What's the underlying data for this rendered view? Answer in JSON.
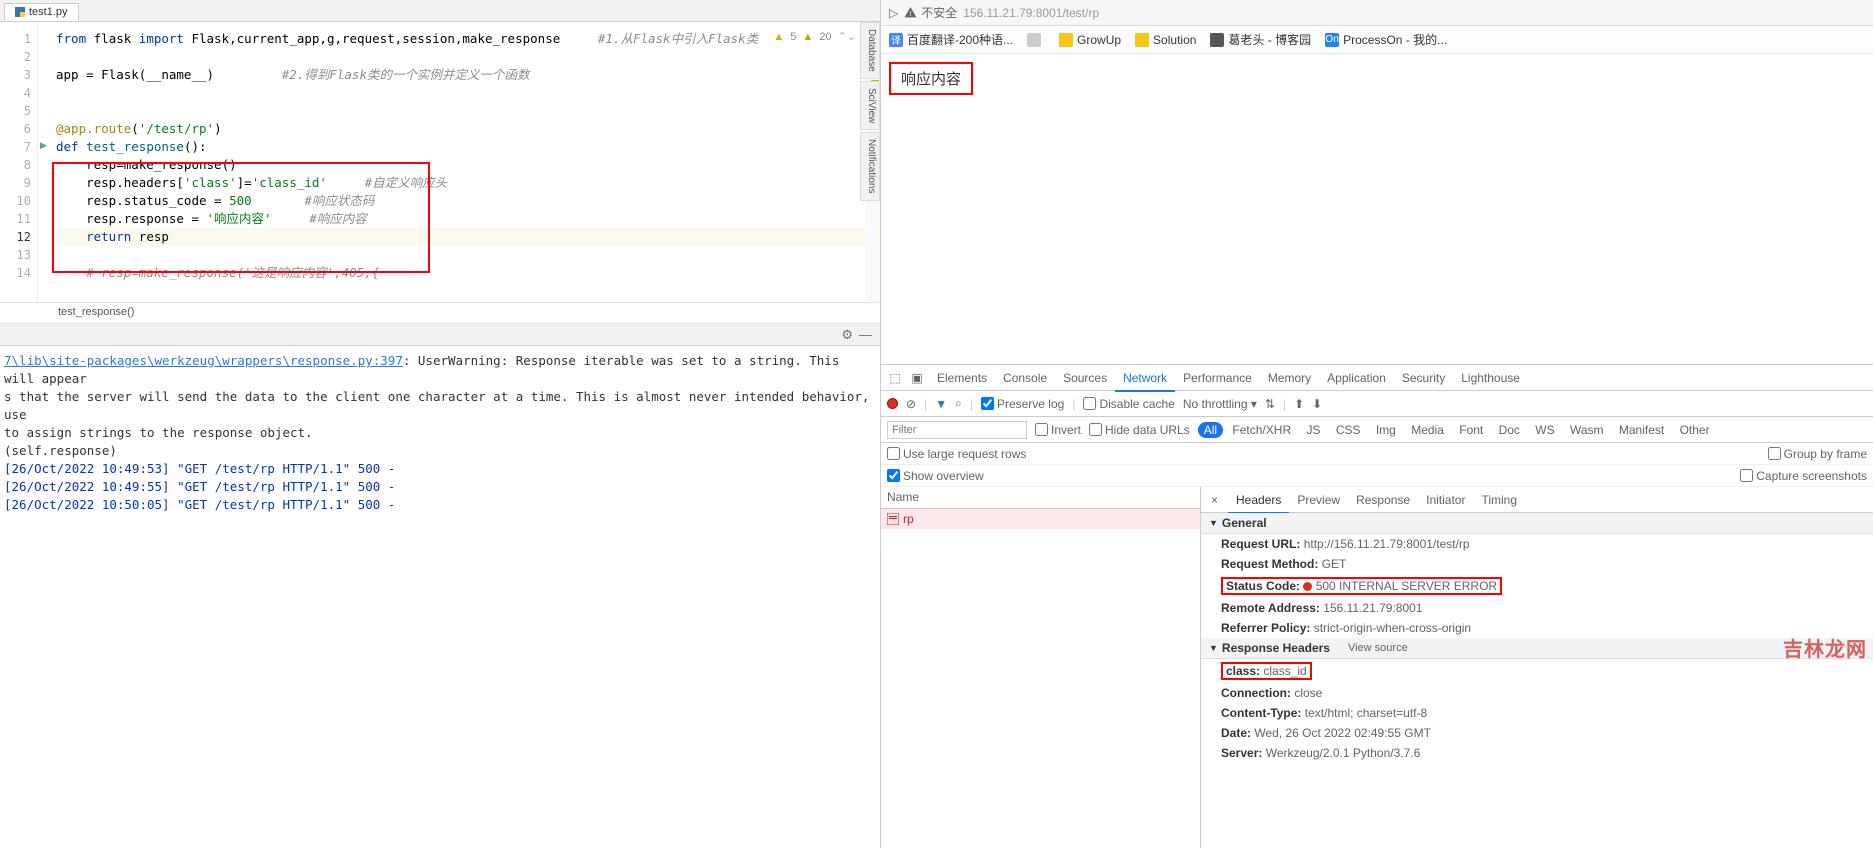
{
  "ide": {
    "tab": {
      "name": "test1.py"
    },
    "inspections": {
      "err": "5",
      "warn": "20"
    },
    "gutter_lines": [
      "1",
      "2",
      "3",
      "4",
      "5",
      "6",
      "7",
      "8",
      "9",
      "10",
      "11",
      "12",
      "13",
      "14"
    ],
    "active_line_idx": 11,
    "code_lines": [
      {
        "parts": [
          {
            "cls": "tok-kw",
            "t": "from "
          },
          {
            "cls": "tok-id",
            "t": "flask "
          },
          {
            "cls": "tok-kw",
            "t": "import "
          },
          {
            "cls": "tok-id",
            "t": "Flask,current_app,g,request,session,make_response     "
          },
          {
            "cls": "tok-cmt",
            "t": "#1.从Flask中引入Flask类"
          }
        ]
      },
      {
        "parts": []
      },
      {
        "parts": [
          {
            "cls": "tok-id",
            "t": "app = Flask(__name__)         "
          },
          {
            "cls": "tok-cmt",
            "t": "#2.得到Flask类的一个实例并定义一个函数"
          }
        ]
      },
      {
        "parts": []
      },
      {
        "parts": []
      },
      {
        "parts": [
          {
            "cls": "tok-dec",
            "t": "@app.route"
          },
          {
            "cls": "tok-punc",
            "t": "("
          },
          {
            "cls": "tok-str",
            "t": "'/test/rp'"
          },
          {
            "cls": "tok-punc",
            "t": ")"
          }
        ]
      },
      {
        "parts": [
          {
            "cls": "tok-kw",
            "t": "def "
          },
          {
            "cls": "tok-deffn",
            "t": "test_response"
          },
          {
            "cls": "tok-punc",
            "t": "():"
          }
        ]
      },
      {
        "parts": [
          {
            "cls": "tok-id",
            "t": "    resp=make_response()"
          }
        ]
      },
      {
        "parts": [
          {
            "cls": "tok-id",
            "t": "    resp.headers["
          },
          {
            "cls": "tok-str",
            "t": "'class'"
          },
          {
            "cls": "tok-id",
            "t": "]="
          },
          {
            "cls": "tok-str",
            "t": "'class_id'"
          },
          {
            "cls": "tok-id",
            "t": "     "
          },
          {
            "cls": "tok-cmt",
            "t": "#自定义响应头"
          }
        ]
      },
      {
        "parts": [
          {
            "cls": "tok-id",
            "t": "    resp.status_code = "
          },
          {
            "cls": "tok-str",
            "t": "500"
          },
          {
            "cls": "tok-id",
            "t": "       "
          },
          {
            "cls": "tok-cmt",
            "t": "#响应状态码"
          }
        ]
      },
      {
        "parts": [
          {
            "cls": "tok-id",
            "t": "    resp.response = "
          },
          {
            "cls": "tok-str",
            "t": "'响应内容'"
          },
          {
            "cls": "tok-id",
            "t": "     "
          },
          {
            "cls": "tok-cmt",
            "t": "#响应内容"
          }
        ]
      },
      {
        "cls": "line-cur",
        "parts": [
          {
            "cls": "tok-kw",
            "t": "    return "
          },
          {
            "cls": "tok-id",
            "t": "resp"
          }
        ]
      },
      {
        "parts": []
      },
      {
        "parts": [
          {
            "cls": "tok-cmt",
            "t": "    # resp=make_response('这是响应内容',405,{"
          }
        ]
      }
    ],
    "breadcrumb": "test_response()",
    "side_tabs": [
      "Database",
      "SciView",
      "Notifications"
    ],
    "console": {
      "warn_path": "7\\lib\\site-packages\\werkzeug\\wrappers\\response.py:397",
      "warn_rest": ": UserWarning: Response iterable was set to a string. This will appear",
      "warn_l2": "s that the server will send the data to the client one character at a time. This is almost never intended behavior, use",
      "warn_l3": "to assign strings to the response object.",
      "warn_l4": "(self.response)",
      "logs": [
        "[26/Oct/2022 10:49:53] \"GET /test/rp HTTP/1.1\" 500 -",
        "[26/Oct/2022 10:49:55] \"GET /test/rp HTTP/1.1\" 500 -",
        "[26/Oct/2022 10:50:05] \"GET /test/rp HTTP/1.1\" 500 -"
      ]
    }
  },
  "browser": {
    "addr_prefix": "▷",
    "not_secure": "不安全",
    "url": "156.11.21.79:8001/test/rp",
    "bookmarks": [
      {
        "ico": "#4285f4",
        "txt": "译",
        "label": "百度翻译-200种语..."
      },
      {
        "ico": "#ccc",
        "txt": "",
        "label": ""
      },
      {
        "ico": "#f5c518",
        "txt": "",
        "label": "GrowUp",
        "folder": true
      },
      {
        "ico": "#f5c518",
        "txt": "",
        "label": "Solution",
        "folder": true
      },
      {
        "ico": "#555",
        "txt": "",
        "label": "葛老头 - 博客园"
      },
      {
        "ico": "#1e88e5",
        "txt": "On",
        "label": "ProcessOn - 我的..."
      }
    ],
    "response_text": "响应内容"
  },
  "devtools": {
    "tabs": [
      "Elements",
      "Console",
      "Sources",
      "Network",
      "Performance",
      "Memory",
      "Application",
      "Security",
      "Lighthouse"
    ],
    "active_tab": "Network",
    "toolbar": {
      "preserve": "Preserve log",
      "disable": "Disable cache",
      "throttle": "No throttling"
    },
    "filter_placeholder": "Filter",
    "invert": "Invert",
    "hide": "Hide data URLs",
    "types": [
      "All",
      "Fetch/XHR",
      "JS",
      "CSS",
      "Img",
      "Media",
      "Font",
      "Doc",
      "WS",
      "Wasm",
      "Manifest",
      "Other"
    ],
    "opt_large": "Use large request rows",
    "opt_group": "Group by frame",
    "opt_over": "Show overview",
    "opt_caps": "Capture screenshots",
    "req_head": "Name",
    "req_name": "rp",
    "detail_tabs": [
      "Headers",
      "Preview",
      "Response",
      "Initiator",
      "Timing"
    ],
    "active_detail": "Headers",
    "general_title": "General",
    "general": {
      "url_k": "Request URL:",
      "url_v": "http://156.11.21.79:8001/test/rp",
      "method_k": "Request Method:",
      "method_v": "GET",
      "status_k": "Status Code:",
      "status_v": "500 INTERNAL SERVER ERROR",
      "remote_k": "Remote Address:",
      "remote_v": "156.11.21.79:8001",
      "ref_k": "Referrer Policy:",
      "ref_v": "strict-origin-when-cross-origin"
    },
    "resp_title": "Response Headers",
    "view_source": "View source",
    "resp": {
      "class_k": "class:",
      "class_v": "class_id",
      "conn_k": "Connection:",
      "conn_v": "close",
      "ct_k": "Content-Type:",
      "ct_v": "text/html; charset=utf-8",
      "date_k": "Date:",
      "date_v": "Wed, 26 Oct 2022 02:49:55 GMT",
      "server_k": "Server:",
      "server_v": "Werkzeug/2.0.1 Python/3.7.6"
    }
  },
  "watermark": "吉林龙网"
}
